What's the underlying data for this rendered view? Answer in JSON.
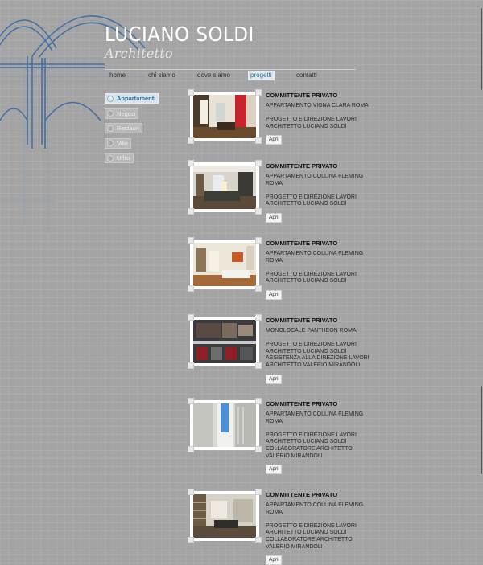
{
  "logo": {
    "title": "LUCIANO SOLDI",
    "subtitle": "Architetto"
  },
  "nav": [
    {
      "label": "home",
      "active": false
    },
    {
      "label": "chi siamo",
      "active": false
    },
    {
      "label": "dove siamo",
      "active": false
    },
    {
      "label": "progetti",
      "active": true
    },
    {
      "label": "contatti",
      "active": false
    }
  ],
  "categories": [
    {
      "label": "Appartamenti",
      "active": true
    },
    {
      "label": "Negozi",
      "active": false
    },
    {
      "label": "Restauri",
      "active": false
    },
    {
      "label": "Ville",
      "active": false
    },
    {
      "label": "Uffici",
      "active": false
    }
  ],
  "projects": [
    {
      "client": "COMMITTENTE PRIVATO",
      "description": [
        "APPARTAMENTO VIGNA CLARA ROMA"
      ],
      "credits": [
        "PROGETTO E DIREZIONE LAVORI",
        "ARCHITETTO LUCIANO SOLDI"
      ],
      "button": "Apri",
      "image": "living-room-red-wall"
    },
    {
      "client": "COMMITTENTE PRIVATO",
      "description": [
        "APPARTAMENTO COLLINA FLEMING",
        "ROMA"
      ],
      "credits": [
        "PROGETTO E DIREZIONE LAVORI",
        "ARCHITETTO LUCIANO SOLDI"
      ],
      "button": "Apri",
      "image": "living-room-sofa"
    },
    {
      "client": "COMMITTENTE PRIVATO",
      "description": [
        "APPARTAMENTO COLLINA FLEMING",
        "ROMA"
      ],
      "credits": [
        "PROGETTO E DIREZIONE LAVORI",
        "ARCHITETTO LUCIANO SOLDI"
      ],
      "button": "Apri",
      "image": "bright-living-room"
    },
    {
      "client": "COMMITTENTE PRIVATO",
      "description": [
        "MONOLOCALE PANTHEON ROMA"
      ],
      "credits": [
        "PROGETTO E DIREZIONE LAVORI",
        "ARCHITETTO LUCIANO SOLDI",
        "ASSISTENZA ALLA DIREZIONE LAVORI",
        "ARCHITETTO VALERIO MIRANDOLI"
      ],
      "button": "Apri",
      "image": "floor-plan-render"
    },
    {
      "client": "COMMITTENTE PRIVATO",
      "description": [
        "APPARTAMENTO COLLINA FLEMING",
        "ROMA"
      ],
      "credits": [
        "PROGETTO E DIREZIONE LAVORI",
        "ARCHITETTO LUCIANO SOLDI",
        "COLLABORATORE ARCHITETTO",
        "VALERIO MIRANDOLI"
      ],
      "button": "Apri",
      "image": "doorway-blue-light"
    },
    {
      "client": "COMMITTENTE PRIVATO",
      "description": [
        "APPARTAMENTO COLLINA FLEMING",
        "ROMA"
      ],
      "credits": [
        "PROGETTO E DIREZIONE LAVORI",
        "ARCHITETTO LUCIANO SOLDI",
        "COLLABORATORE ARCHITETTO",
        "VALERIO MIRANDOLI"
      ],
      "button": "Apri",
      "image": "library-living-room"
    }
  ],
  "colors": {
    "accent": "#2b6f9c",
    "background": "#a4a4a4",
    "sketch": "#2f5f9a"
  }
}
